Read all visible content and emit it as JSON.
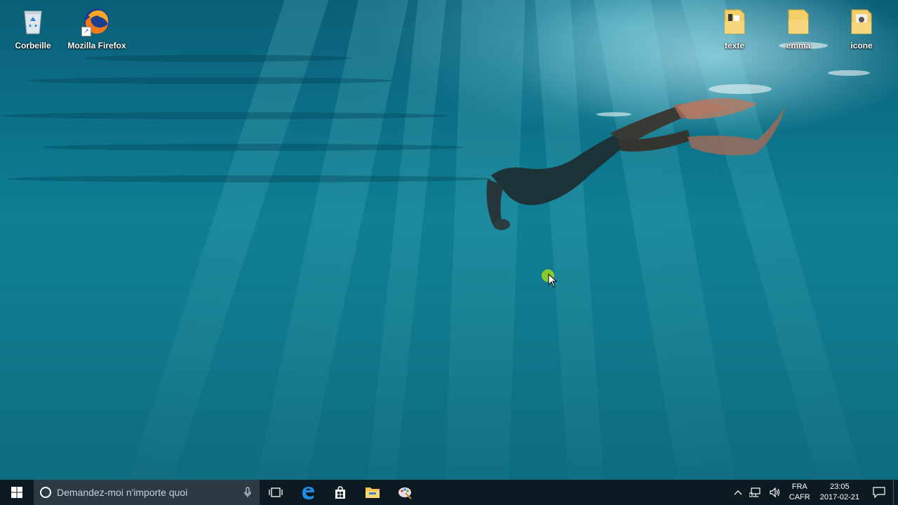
{
  "desktop": {
    "icons_left": [
      {
        "label": "Corbeille",
        "icon": "recycle-bin-icon"
      },
      {
        "label": "Mozilla Firefox",
        "icon": "firefox-icon"
      }
    ],
    "icons_right": [
      {
        "label": "texte",
        "icon": "folder-icon"
      },
      {
        "label": "emma",
        "icon": "folder-icon"
      },
      {
        "label": "icone",
        "icon": "folder-icon"
      }
    ]
  },
  "taskbar": {
    "search_placeholder": "Demandez-moi n'importe quoi",
    "pinned": [
      {
        "name": "task-view",
        "icon": "task-view-icon"
      },
      {
        "name": "edge",
        "icon": "edge-icon"
      },
      {
        "name": "store",
        "icon": "store-icon"
      },
      {
        "name": "file-explorer",
        "icon": "folder-icon"
      },
      {
        "name": "paint",
        "icon": "paint-icon"
      }
    ],
    "tray": {
      "lang_line1": "FRA",
      "lang_line2": "CAFR",
      "time": "23:05",
      "date": "2017-02-21"
    }
  },
  "colors": {
    "taskbar_bg": "#0e1a22",
    "search_bg": "#2b3a43",
    "water_deep": "#0a5f78",
    "water_mid": "#117a8e"
  }
}
